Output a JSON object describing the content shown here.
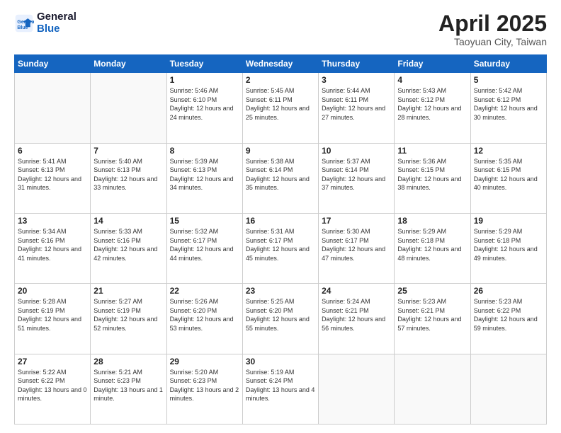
{
  "header": {
    "logo_line1": "General",
    "logo_line2": "Blue",
    "title": "April 2025",
    "subtitle": "Taoyuan City, Taiwan"
  },
  "weekdays": [
    "Sunday",
    "Monday",
    "Tuesday",
    "Wednesday",
    "Thursday",
    "Friday",
    "Saturday"
  ],
  "weeks": [
    [
      {
        "day": "",
        "info": ""
      },
      {
        "day": "",
        "info": ""
      },
      {
        "day": "1",
        "info": "Sunrise: 5:46 AM\nSunset: 6:10 PM\nDaylight: 12 hours and 24 minutes."
      },
      {
        "day": "2",
        "info": "Sunrise: 5:45 AM\nSunset: 6:11 PM\nDaylight: 12 hours and 25 minutes."
      },
      {
        "day": "3",
        "info": "Sunrise: 5:44 AM\nSunset: 6:11 PM\nDaylight: 12 hours and 27 minutes."
      },
      {
        "day": "4",
        "info": "Sunrise: 5:43 AM\nSunset: 6:12 PM\nDaylight: 12 hours and 28 minutes."
      },
      {
        "day": "5",
        "info": "Sunrise: 5:42 AM\nSunset: 6:12 PM\nDaylight: 12 hours and 30 minutes."
      }
    ],
    [
      {
        "day": "6",
        "info": "Sunrise: 5:41 AM\nSunset: 6:13 PM\nDaylight: 12 hours and 31 minutes."
      },
      {
        "day": "7",
        "info": "Sunrise: 5:40 AM\nSunset: 6:13 PM\nDaylight: 12 hours and 33 minutes."
      },
      {
        "day": "8",
        "info": "Sunrise: 5:39 AM\nSunset: 6:13 PM\nDaylight: 12 hours and 34 minutes."
      },
      {
        "day": "9",
        "info": "Sunrise: 5:38 AM\nSunset: 6:14 PM\nDaylight: 12 hours and 35 minutes."
      },
      {
        "day": "10",
        "info": "Sunrise: 5:37 AM\nSunset: 6:14 PM\nDaylight: 12 hours and 37 minutes."
      },
      {
        "day": "11",
        "info": "Sunrise: 5:36 AM\nSunset: 6:15 PM\nDaylight: 12 hours and 38 minutes."
      },
      {
        "day": "12",
        "info": "Sunrise: 5:35 AM\nSunset: 6:15 PM\nDaylight: 12 hours and 40 minutes."
      }
    ],
    [
      {
        "day": "13",
        "info": "Sunrise: 5:34 AM\nSunset: 6:16 PM\nDaylight: 12 hours and 41 minutes."
      },
      {
        "day": "14",
        "info": "Sunrise: 5:33 AM\nSunset: 6:16 PM\nDaylight: 12 hours and 42 minutes."
      },
      {
        "day": "15",
        "info": "Sunrise: 5:32 AM\nSunset: 6:17 PM\nDaylight: 12 hours and 44 minutes."
      },
      {
        "day": "16",
        "info": "Sunrise: 5:31 AM\nSunset: 6:17 PM\nDaylight: 12 hours and 45 minutes."
      },
      {
        "day": "17",
        "info": "Sunrise: 5:30 AM\nSunset: 6:17 PM\nDaylight: 12 hours and 47 minutes."
      },
      {
        "day": "18",
        "info": "Sunrise: 5:29 AM\nSunset: 6:18 PM\nDaylight: 12 hours and 48 minutes."
      },
      {
        "day": "19",
        "info": "Sunrise: 5:29 AM\nSunset: 6:18 PM\nDaylight: 12 hours and 49 minutes."
      }
    ],
    [
      {
        "day": "20",
        "info": "Sunrise: 5:28 AM\nSunset: 6:19 PM\nDaylight: 12 hours and 51 minutes."
      },
      {
        "day": "21",
        "info": "Sunrise: 5:27 AM\nSunset: 6:19 PM\nDaylight: 12 hours and 52 minutes."
      },
      {
        "day": "22",
        "info": "Sunrise: 5:26 AM\nSunset: 6:20 PM\nDaylight: 12 hours and 53 minutes."
      },
      {
        "day": "23",
        "info": "Sunrise: 5:25 AM\nSunset: 6:20 PM\nDaylight: 12 hours and 55 minutes."
      },
      {
        "day": "24",
        "info": "Sunrise: 5:24 AM\nSunset: 6:21 PM\nDaylight: 12 hours and 56 minutes."
      },
      {
        "day": "25",
        "info": "Sunrise: 5:23 AM\nSunset: 6:21 PM\nDaylight: 12 hours and 57 minutes."
      },
      {
        "day": "26",
        "info": "Sunrise: 5:23 AM\nSunset: 6:22 PM\nDaylight: 12 hours and 59 minutes."
      }
    ],
    [
      {
        "day": "27",
        "info": "Sunrise: 5:22 AM\nSunset: 6:22 PM\nDaylight: 13 hours and 0 minutes."
      },
      {
        "day": "28",
        "info": "Sunrise: 5:21 AM\nSunset: 6:23 PM\nDaylight: 13 hours and 1 minute."
      },
      {
        "day": "29",
        "info": "Sunrise: 5:20 AM\nSunset: 6:23 PM\nDaylight: 13 hours and 2 minutes."
      },
      {
        "day": "30",
        "info": "Sunrise: 5:19 AM\nSunset: 6:24 PM\nDaylight: 13 hours and 4 minutes."
      },
      {
        "day": "",
        "info": ""
      },
      {
        "day": "",
        "info": ""
      },
      {
        "day": "",
        "info": ""
      }
    ]
  ]
}
